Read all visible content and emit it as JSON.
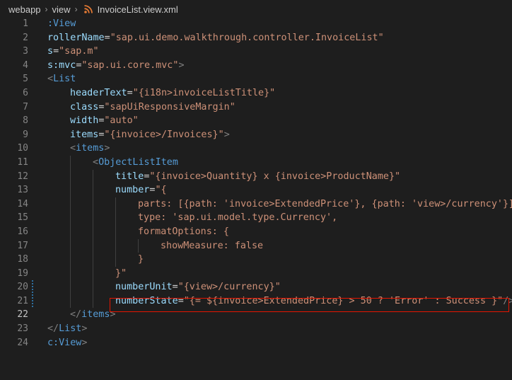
{
  "breadcrumb": {
    "items": [
      "webapp",
      "view",
      "InvoiceList.view.xml"
    ],
    "separator": "›",
    "file_icon": "rss-icon",
    "file_icon_color": "#e37933"
  },
  "editor": {
    "active_line": 22,
    "highlighted_line": 21,
    "modified_lines": [
      20,
      21
    ],
    "lines": [
      {
        "n": "1",
        "indent": 0,
        "parts": [
          {
            "t": ":View",
            "c": "tag"
          }
        ]
      },
      {
        "n": "2",
        "indent": 0,
        "parts": [
          {
            "t": "rollerName",
            "c": "attr"
          },
          {
            "t": "=",
            "c": "op"
          },
          {
            "t": "\"sap.ui.demo.walkthrough.controller.InvoiceList\"",
            "c": "str"
          }
        ]
      },
      {
        "n": "3",
        "indent": 0,
        "parts": [
          {
            "t": "s",
            "c": "attr"
          },
          {
            "t": "=",
            "c": "op"
          },
          {
            "t": "\"sap.m\"",
            "c": "str"
          }
        ]
      },
      {
        "n": "4",
        "indent": 0,
        "parts": [
          {
            "t": "s:mvc",
            "c": "attr"
          },
          {
            "t": "=",
            "c": "op"
          },
          {
            "t": "\"sap.ui.core.mvc\"",
            "c": "str"
          },
          {
            "t": ">",
            "c": "bracket"
          }
        ]
      },
      {
        "n": "5",
        "indent": 0,
        "parts": [
          {
            "t": "<",
            "c": "bracket"
          },
          {
            "t": "List",
            "c": "tag"
          }
        ]
      },
      {
        "n": "6",
        "indent": 1,
        "parts": [
          {
            "t": "headerText",
            "c": "attr"
          },
          {
            "t": "=",
            "c": "op"
          },
          {
            "t": "\"{i18n>invoiceListTitle}\"",
            "c": "str"
          }
        ]
      },
      {
        "n": "7",
        "indent": 1,
        "parts": [
          {
            "t": "class",
            "c": "attr"
          },
          {
            "t": "=",
            "c": "op"
          },
          {
            "t": "\"sapUiResponsiveMargin\"",
            "c": "str"
          }
        ]
      },
      {
        "n": "8",
        "indent": 1,
        "parts": [
          {
            "t": "width",
            "c": "attr"
          },
          {
            "t": "=",
            "c": "op"
          },
          {
            "t": "\"auto\"",
            "c": "str"
          }
        ]
      },
      {
        "n": "9",
        "indent": 1,
        "parts": [
          {
            "t": "items",
            "c": "attr"
          },
          {
            "t": "=",
            "c": "op"
          },
          {
            "t": "\"{invoice>/Invoices}\"",
            "c": "str"
          },
          {
            "t": ">",
            "c": "bracket"
          }
        ]
      },
      {
        "n": "10",
        "indent": 1,
        "parts": [
          {
            "t": "<",
            "c": "bracket"
          },
          {
            "t": "items",
            "c": "tag"
          },
          {
            "t": ">",
            "c": "bracket"
          }
        ]
      },
      {
        "n": "11",
        "indent": 2,
        "parts": [
          {
            "t": "<",
            "c": "bracket"
          },
          {
            "t": "ObjectListItem",
            "c": "tag"
          }
        ]
      },
      {
        "n": "12",
        "indent": 3,
        "parts": [
          {
            "t": "title",
            "c": "attr"
          },
          {
            "t": "=",
            "c": "op"
          },
          {
            "t": "\"{invoice>Quantity} x {invoice>ProductName}\"",
            "c": "str"
          }
        ]
      },
      {
        "n": "13",
        "indent": 3,
        "parts": [
          {
            "t": "number",
            "c": "attr"
          },
          {
            "t": "=",
            "c": "op"
          },
          {
            "t": "\"{",
            "c": "str"
          }
        ]
      },
      {
        "n": "14",
        "indent": 4,
        "parts": [
          {
            "t": "parts: [{path: 'invoice>ExtendedPrice'}, {path: 'view>/currency'}]",
            "c": "str"
          }
        ]
      },
      {
        "n": "15",
        "indent": 4,
        "parts": [
          {
            "t": "type: 'sap.ui.model.type.Currency',",
            "c": "str"
          }
        ]
      },
      {
        "n": "16",
        "indent": 4,
        "parts": [
          {
            "t": "formatOptions: {",
            "c": "str"
          }
        ]
      },
      {
        "n": "17",
        "indent": 5,
        "parts": [
          {
            "t": "showMeasure: false",
            "c": "str"
          }
        ]
      },
      {
        "n": "18",
        "indent": 4,
        "parts": [
          {
            "t": "}",
            "c": "str"
          }
        ]
      },
      {
        "n": "19",
        "indent": 3,
        "parts": [
          {
            "t": "}\"",
            "c": "str"
          }
        ]
      },
      {
        "n": "20",
        "indent": 3,
        "parts": [
          {
            "t": "numberUnit",
            "c": "attr"
          },
          {
            "t": "=",
            "c": "op"
          },
          {
            "t": "\"{view>/currency}\"",
            "c": "str"
          }
        ]
      },
      {
        "n": "21",
        "indent": 3,
        "parts": [
          {
            "t": "numberState",
            "c": "attr"
          },
          {
            "t": "=",
            "c": "op"
          },
          {
            "t": "\"{= ${invoice>ExtendedPrice} > 50 ? 'Error' : Success }\"",
            "c": "str"
          },
          {
            "t": "/>",
            "c": "bracket"
          }
        ]
      },
      {
        "n": "22",
        "indent": 1,
        "parts": [
          {
            "t": "</",
            "c": "bracket"
          },
          {
            "t": "items",
            "c": "tag"
          },
          {
            "t": ">",
            "c": "bracket"
          }
        ]
      },
      {
        "n": "23",
        "indent": 0,
        "parts": [
          {
            "t": "</",
            "c": "bracket"
          },
          {
            "t": "List",
            "c": "tag"
          },
          {
            "t": ">",
            "c": "bracket"
          }
        ]
      },
      {
        "n": "24",
        "indent": 0,
        "parts": [
          {
            "t": "c:View",
            "c": "tag"
          },
          {
            "t": ">",
            "c": "bracket"
          }
        ]
      }
    ]
  },
  "colors": {
    "background": "#1e1e1e",
    "tag": "#569cd6",
    "attribute": "#9cdcfe",
    "string": "#ce9178",
    "bracket": "#808080",
    "line_number": "#858585",
    "highlight_border": "#e51400"
  }
}
